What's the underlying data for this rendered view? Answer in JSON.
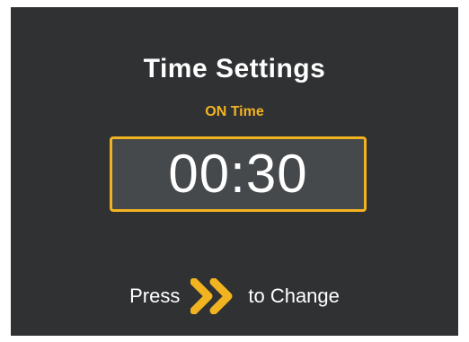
{
  "screen": {
    "title": "Time Settings",
    "subtitle": "ON Time",
    "time_value": "00:30",
    "hint_prefix": "Press",
    "hint_icon": "double-chevron-right-icon",
    "hint_suffix": "to Change"
  },
  "colors": {
    "background": "#2f3133",
    "accent": "#f2b320",
    "box_fill": "#45494c",
    "text": "#ffffff"
  }
}
